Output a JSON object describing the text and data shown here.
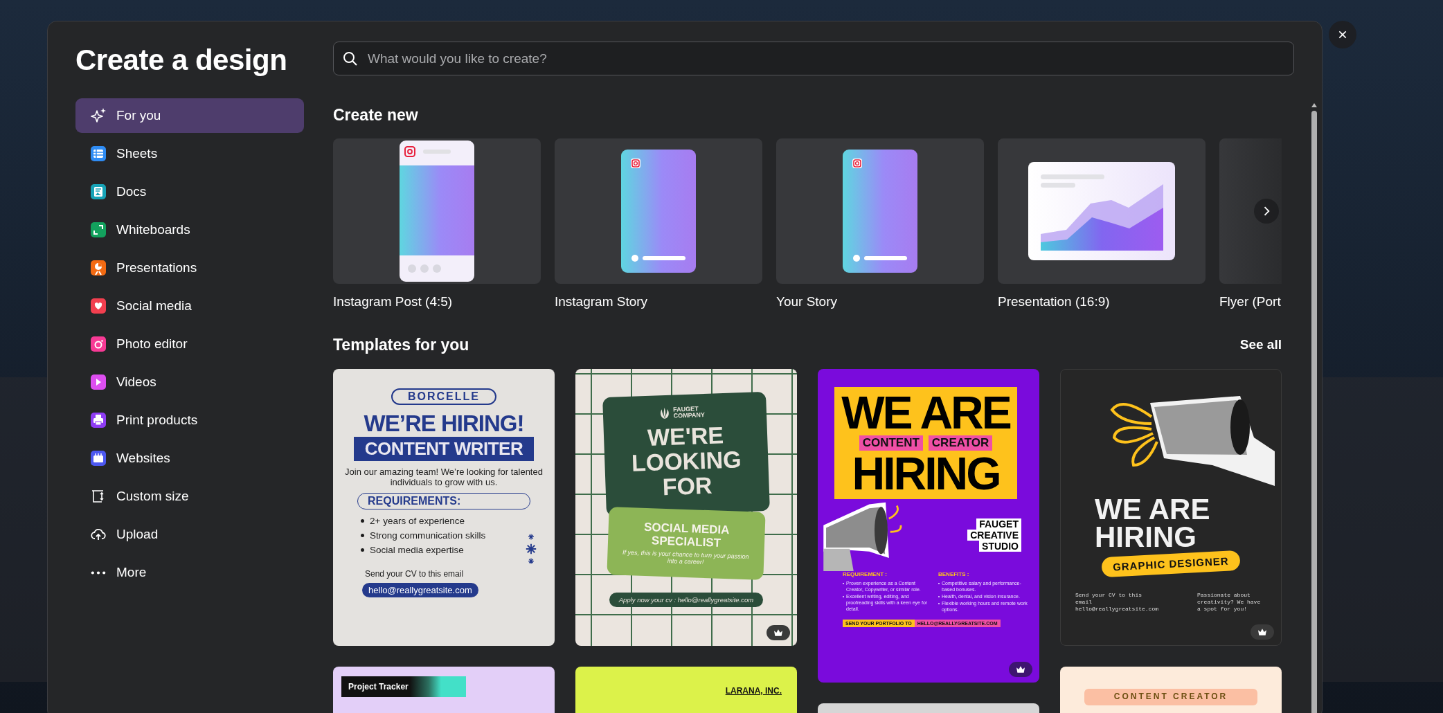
{
  "dialog": {
    "title": "Create a design"
  },
  "sidebar": {
    "items": [
      {
        "kind": "sparkles",
        "label": "For you",
        "selected": true
      },
      {
        "kind": "sheets",
        "label": "Sheets",
        "selected": false
      },
      {
        "kind": "docs",
        "label": "Docs",
        "selected": false
      },
      {
        "kind": "whiteboards",
        "label": "Whiteboards",
        "selected": false
      },
      {
        "kind": "presentations",
        "label": "Presentations",
        "selected": false
      },
      {
        "kind": "social",
        "label": "Social media",
        "selected": false
      },
      {
        "kind": "photo",
        "label": "Photo editor",
        "selected": false
      },
      {
        "kind": "videos",
        "label": "Videos",
        "selected": false
      },
      {
        "kind": "print",
        "label": "Print products",
        "selected": false
      },
      {
        "kind": "websites",
        "label": "Websites",
        "selected": false
      },
      {
        "kind": "custom",
        "label": "Custom size",
        "selected": false
      },
      {
        "kind": "upload",
        "label": "Upload",
        "selected": false
      },
      {
        "kind": "more",
        "label": "More",
        "selected": false
      }
    ]
  },
  "search": {
    "placeholder": "What would you like to create?"
  },
  "create_new": {
    "heading": "Create new",
    "items": [
      {
        "kind": "post",
        "label": "Instagram Post (4:5)"
      },
      {
        "kind": "story",
        "label": "Instagram Story"
      },
      {
        "kind": "story",
        "label": "Your Story"
      },
      {
        "kind": "presentation",
        "label": "Presentation (16:9)"
      },
      {
        "kind": "flyer",
        "label": "Flyer (Port"
      }
    ]
  },
  "templates": {
    "heading": "Templates for you",
    "see_all": "See all",
    "columns": [
      {
        "cards": [
          {
            "kind": "hiring-poster",
            "brand": "BORCELLE",
            "headline": "WE’RE HIRING!",
            "role": "CONTENT WRITER",
            "intro": "Join our amazing team! We’re looking for talented individuals to grow with us.",
            "requirements_title": "REQUIREMENTS:",
            "requirements": [
              "2+ years of experience",
              "Strong communication skills",
              "Social media expertise"
            ],
            "cta": "Send your CV to this email",
            "email": "hello@reallygreatsite.com"
          },
          {
            "kind": "tracker",
            "title": "Project Tracker"
          }
        ]
      },
      {
        "cards": [
          {
            "kind": "looking-poster",
            "premium": true,
            "brand": "FAUGET COMPANY",
            "headline": "WE'RE LOOKING FOR",
            "role": "SOCIAL MEDIA SPECIALIST",
            "tagline": "If yes, this is your chance to turn your passion into a career!",
            "apply": "Apply now your cv : hello@reallygreatsite.com"
          },
          {
            "kind": "company",
            "name": "LARANA, INC."
          }
        ]
      },
      {
        "cards": [
          {
            "kind": "purple-poster",
            "premium": true,
            "headline_top": "WE ARE",
            "headline_bottom": "HIRING",
            "tags": [
              "CONTENT",
              "CREATOR"
            ],
            "studio": [
              "FAUGET",
              "CREATIVE",
              "STUDIO"
            ],
            "lists": [
              {
                "title": "REQUIREMENT :",
                "items": [
                  "Proven experience as a Content Creator, Copywriter, or similar role.",
                  "Excellent writing, editing, and proofreading skills with a keen eye for detail."
                ]
              },
              {
                "title": "BENEFITS :",
                "items": [
                  "Competitive salary and performance-based bonuses.",
                  "Health, dental, and vision insurance.",
                  "Flexible working hours and remote work options."
                ]
              }
            ],
            "cta": "SEND YOUR PORTFOLIO TO",
            "email": "HELLO@REALLYGREATSITE.COM"
          },
          {
            "kind": "plain"
          }
        ]
      },
      {
        "cards": [
          {
            "kind": "megaphone-poster",
            "premium": true,
            "headline": "WE ARE HIRING",
            "role": "GRAPHIC DESIGNER",
            "contact": "Send your CV to this email hello@reallygreatsite.com",
            "note": "Passionate about creativity? We have a spot for you!"
          },
          {
            "kind": "role-card",
            "role": "CONTENT CREATOR"
          }
        ]
      }
    ]
  }
}
